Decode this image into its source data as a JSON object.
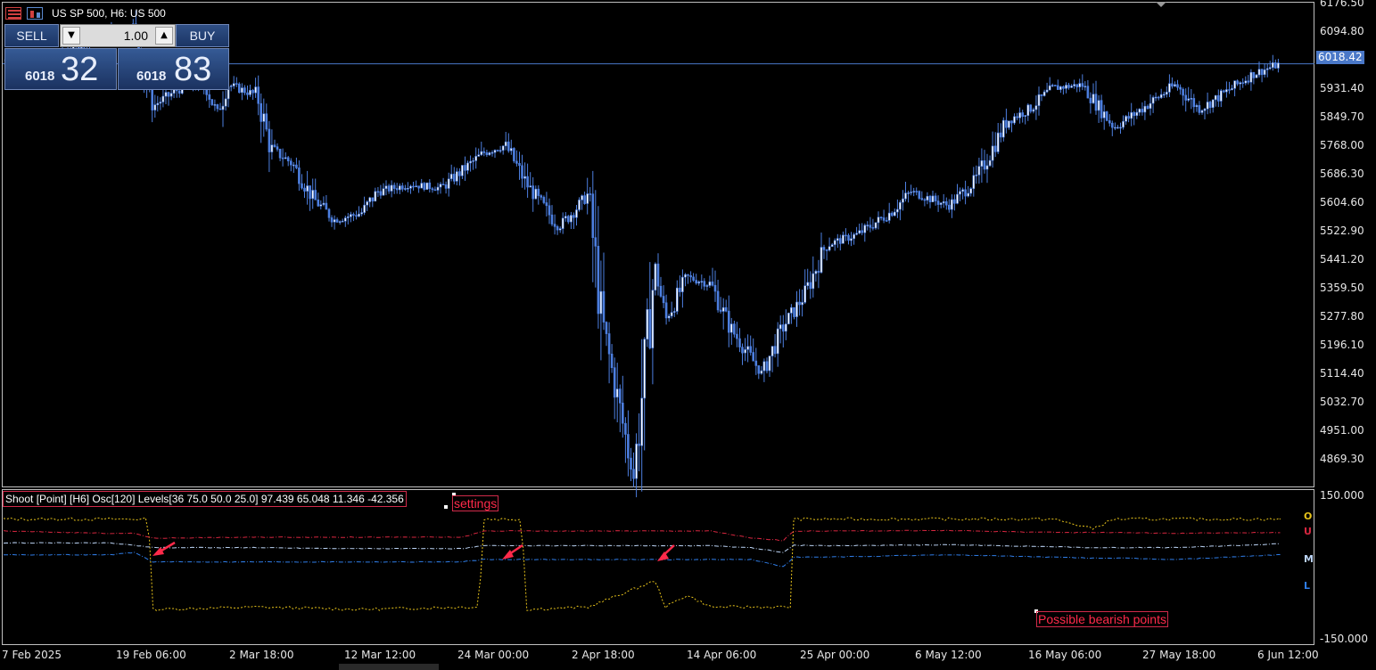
{
  "header": {
    "title": "US SP 500, H6:  US 500"
  },
  "trade_panel": {
    "sell_label": "SELL",
    "buy_label": "BUY",
    "lot_value": "1.00",
    "bid_prefix": "6018",
    "bid_big": "32",
    "ask_prefix": "6018",
    "ask_big": "83"
  },
  "current_price": "6018.42",
  "price_axis": [
    "6176.50",
    "6094.80",
    "5931.40",
    "5849.70",
    "5768.00",
    "5686.30",
    "5604.60",
    "5522.90",
    "5441.20",
    "5359.50",
    "5277.80",
    "5196.10",
    "5114.40",
    "5032.70",
    "4951.00",
    "4869.30"
  ],
  "osc_axis": [
    "150.000",
    "-150.000"
  ],
  "time_axis": [
    "7 Feb 2025",
    "19 Feb 06:00",
    "2 Mar 18:00",
    "12 Mar 12:00",
    "24 Mar 00:00",
    "2 Apr 18:00",
    "14 Apr 06:00",
    "25 Apr 00:00",
    "6 May 12:00",
    "16 May 06:00",
    "27 May 18:00",
    "6 Jun 12:00"
  ],
  "indicator": {
    "header": "Shoot [Point] [H6]  Osc[120]  Levels[36 75.0 50.0 25.0] 97.439 65.048 11.346 -42.356",
    "settings_label": "settings",
    "bearish_label": "Possible bearish points",
    "legend": [
      "O",
      "U",
      "M",
      "L"
    ]
  },
  "colors": {
    "candle": "#4d7fe0",
    "osc": "#e6c21a",
    "upper": "#d6263f",
    "mid": "#bcd4f5",
    "lower": "#2f7de8",
    "annotation": "#ff2a4a"
  },
  "chart_data": [
    {
      "type": "candlestick",
      "title": "US SP 500, H6:  US 500",
      "ylim": [
        4830,
        6190
      ],
      "x_range": [
        "7 Feb 2025",
        "6 Jun 12:00"
      ],
      "current_price": 6018.42,
      "close_path": [
        [
          "7 Feb 2025",
          6030
        ],
        [
          "12 Feb 2025",
          6040
        ],
        [
          "17 Feb 2025",
          6110
        ],
        [
          "19 Feb 06:00",
          6120
        ],
        [
          "21 Feb 2025",
          5900
        ],
        [
          "24 Feb 2025",
          5960
        ],
        [
          "26 Feb 2025",
          5950
        ],
        [
          "27 Feb 2025",
          5880
        ],
        [
          "28 Feb 2025",
          5960
        ],
        [
          "2 Mar 18:00",
          5930
        ],
        [
          "4 Mar 2025",
          5780
        ],
        [
          "6 Mar 2025",
          5740
        ],
        [
          "8 Mar 2025",
          5640
        ],
        [
          "10 Mar 2025",
          5580
        ],
        [
          "12 Mar 12:00",
          5600
        ],
        [
          "14 Mar 2025",
          5660
        ],
        [
          "17 Mar 2025",
          5680
        ],
        [
          "20 Mar 2025",
          5670
        ],
        [
          "24 Mar 00:00",
          5770
        ],
        [
          "26 Mar 2025",
          5790
        ],
        [
          "28 Mar 2025",
          5680
        ],
        [
          "31 Mar 2025",
          5560
        ],
        [
          "2 Apr 18:00",
          5650
        ],
        [
          "4 Apr 2025",
          5300
        ],
        [
          "7 Apr 2025",
          4860
        ],
        [
          "9 Apr 2025",
          5450
        ],
        [
          "10 Apr 2025",
          5300
        ],
        [
          "12 Apr 2025",
          5420
        ],
        [
          "14 Apr 06:00",
          5400
        ],
        [
          "16 Apr 2025",
          5280
        ],
        [
          "19 Apr 2025",
          5150
        ],
        [
          "21 Apr 2025",
          5280
        ],
        [
          "23 Apr 2025",
          5370
        ],
        [
          "25 Apr 00:00",
          5510
        ],
        [
          "28 Apr 2025",
          5540
        ],
        [
          "1 May 2025",
          5600
        ],
        [
          "3 May 2025",
          5660
        ],
        [
          "6 May 12:00",
          5620
        ],
        [
          "9 May 2025",
          5690
        ],
        [
          "12 May 2025",
          5860
        ],
        [
          "14 May 2025",
          5890
        ],
        [
          "16 May 06:00",
          5950
        ],
        [
          "19 May 2025",
          5960
        ],
        [
          "22 May 2025",
          5840
        ],
        [
          "24 May 2025",
          5880
        ],
        [
          "27 May 18:00",
          5960
        ],
        [
          "30 May 2025",
          5890
        ],
        [
          "2 Jun 2025",
          5950
        ],
        [
          "4 Jun 2025",
          5990
        ],
        [
          "6 Jun 12:00",
          6018
        ]
      ]
    },
    {
      "type": "line",
      "title": "Shoot [Point] [H6]  Osc[120]  Levels[36 75.0 50.0 25.0] 97.439 65.048 11.346 -42.356",
      "ylim": [
        -150,
        150
      ],
      "x": [
        "7 Feb 2025",
        "17 Feb 2025",
        "19 Feb 06:00",
        "21 Feb 2025",
        "2 Mar 18:00",
        "12 Mar 12:00",
        "22 Mar 2025",
        "24 Mar 00:00",
        "26 Mar 2025",
        "28 Mar 2025",
        "2 Apr 18:00",
        "9 Apr 2025",
        "10 Apr 2025",
        "12 Apr 2025",
        "14 Apr 06:00",
        "18 Apr 2025",
        "21 Apr 2025",
        "22 Apr 2025",
        "25 Apr 00:00",
        "6 May 12:00",
        "16 May 06:00",
        "20 May 2025",
        "22 May 2025",
        "27 May 18:00",
        "6 Jun 12:00"
      ],
      "series": [
        {
          "name": "O",
          "values": [
            100,
            100,
            100,
            -90,
            -85,
            -90,
            -85,
            100,
            100,
            -90,
            -85,
            -30,
            -85,
            -60,
            -85,
            -85,
            -85,
            100,
            100,
            100,
            100,
            80,
            100,
            100,
            100
          ]
        },
        {
          "name": "U",
          "values": [
            75,
            70,
            70,
            60,
            62,
            62,
            62,
            75,
            75,
            75,
            75,
            75,
            75,
            75,
            75,
            60,
            55,
            75,
            75,
            76,
            72,
            72,
            72,
            70,
            72
          ]
        },
        {
          "name": "M",
          "values": [
            50,
            50,
            45,
            40,
            40,
            38,
            38,
            44,
            44,
            44,
            44,
            44,
            44,
            44,
            44,
            40,
            30,
            45,
            44,
            46,
            42,
            40,
            40,
            40,
            48
          ]
        },
        {
          "name": "L",
          "values": [
            25,
            25,
            30,
            10,
            10,
            10,
            10,
            15,
            15,
            15,
            15,
            15,
            15,
            15,
            15,
            15,
            0,
            20,
            20,
            25,
            20,
            18,
            18,
            15,
            25
          ]
        }
      ]
    }
  ]
}
